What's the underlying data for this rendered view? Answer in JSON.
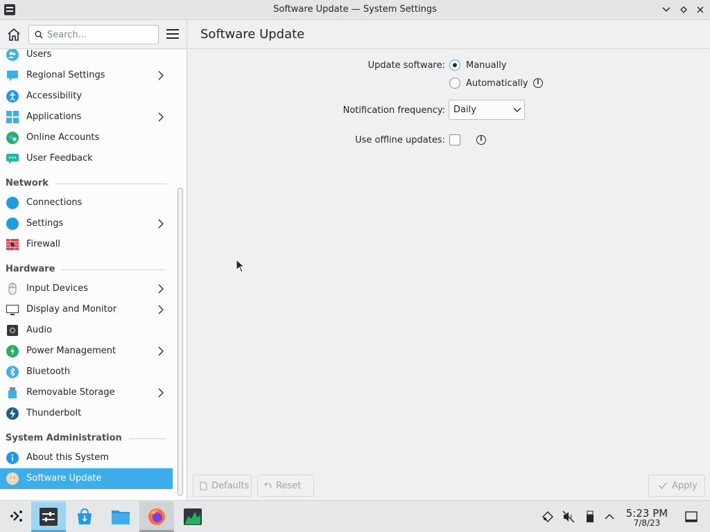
{
  "window": {
    "title": "Software Update — System Settings"
  },
  "header": {
    "search_placeholder": "Search...",
    "page_title": "Software Update"
  },
  "colors": {
    "accent": "#3daee9",
    "selection_text": "#ffffff"
  },
  "sidebar": {
    "items": [
      {
        "label": "Users",
        "icon": "users-icon",
        "has_arrow": false
      },
      {
        "label": "Regional Settings",
        "icon": "regional-settings-icon",
        "has_arrow": true
      },
      {
        "label": "Accessibility",
        "icon": "accessibility-icon",
        "has_arrow": false
      },
      {
        "label": "Applications",
        "icon": "applications-icon",
        "has_arrow": true
      },
      {
        "label": "Online Accounts",
        "icon": "online-accounts-icon",
        "has_arrow": false
      },
      {
        "label": "User Feedback",
        "icon": "user-feedback-icon",
        "has_arrow": false
      }
    ],
    "network": {
      "title": "Network",
      "items": [
        {
          "label": "Connections",
          "icon": "globe-icon",
          "has_arrow": false
        },
        {
          "label": "Settings",
          "icon": "globe-icon",
          "has_arrow": true
        },
        {
          "label": "Firewall",
          "icon": "firewall-icon",
          "has_arrow": false
        }
      ]
    },
    "hardware": {
      "title": "Hardware",
      "items": [
        {
          "label": "Input Devices",
          "icon": "mouse-icon",
          "has_arrow": true
        },
        {
          "label": "Display and Monitor",
          "icon": "monitor-icon",
          "has_arrow": true
        },
        {
          "label": "Audio",
          "icon": "speaker-icon",
          "has_arrow": false
        },
        {
          "label": "Power Management",
          "icon": "power-icon",
          "has_arrow": true
        },
        {
          "label": "Bluetooth",
          "icon": "bluetooth-icon",
          "has_arrow": false
        },
        {
          "label": "Removable Storage",
          "icon": "usb-icon",
          "has_arrow": true
        },
        {
          "label": "Thunderbolt",
          "icon": "thunderbolt-icon",
          "has_arrow": false
        }
      ]
    },
    "sysadmin": {
      "title": "System Administration",
      "items": [
        {
          "label": "About this System",
          "icon": "info-icon",
          "has_arrow": false
        },
        {
          "label": "Software Update",
          "icon": "software-update-icon",
          "has_arrow": false,
          "selected": true
        }
      ]
    }
  },
  "form": {
    "update_software_label": "Update software:",
    "update_options": [
      {
        "label": "Manually",
        "checked": true
      },
      {
        "label": "Automatically",
        "checked": false
      }
    ],
    "notification_label": "Notification frequency:",
    "notification_value": "Daily",
    "offline_label": "Use offline updates:",
    "offline_checked": false
  },
  "buttons": {
    "defaults": "Defaults",
    "reset": "Reset",
    "apply": "Apply"
  },
  "taskbar": {
    "apps": [
      {
        "name": "application-launcher",
        "active": false
      },
      {
        "name": "system-settings",
        "active": true
      },
      {
        "name": "discover",
        "active": false
      },
      {
        "name": "file-manager",
        "active": false
      },
      {
        "name": "firefox",
        "active": false,
        "hover": true
      },
      {
        "name": "system-monitor",
        "active": false
      }
    ],
    "clock": {
      "time": "5:23 PM",
      "date": "7/8/23"
    }
  }
}
